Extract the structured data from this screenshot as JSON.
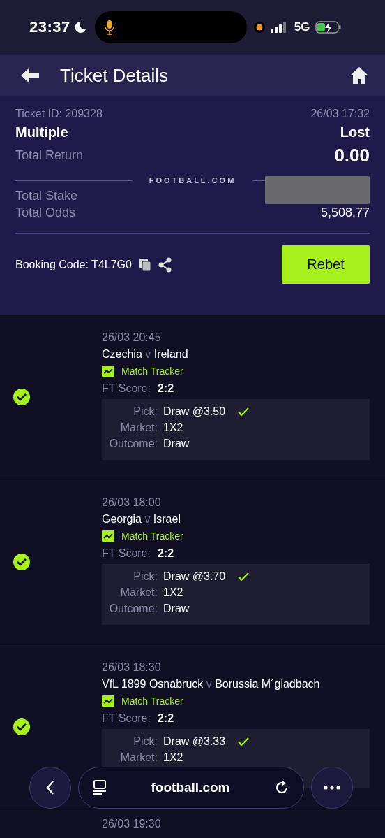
{
  "status_bar": {
    "time": "23:37",
    "network": "5G"
  },
  "header": {
    "title": "Ticket Details"
  },
  "ticket": {
    "ticket_id": "Ticket ID: 209328",
    "date": "26/03 17:32",
    "type": "Multiple",
    "result": "Lost",
    "return_label": "Total Return",
    "return_value": "0.00",
    "divider_logo": "FOOTBALL.COM",
    "stake_label": "Total Stake",
    "odds_label": "Total Odds",
    "odds_value": "5,508.77",
    "booking_code": "Booking Code: T4L7G0",
    "rebet": "Rebet"
  },
  "matches": [
    {
      "date": "26/03 20:45",
      "home": "Czechia",
      "vs": "v",
      "away": "Ireland",
      "tracker": "Match Tracker",
      "score_label": "FT Score:",
      "score": "2:2",
      "pick_label": "Pick:",
      "pick": "Draw @3.50",
      "pick_won": true,
      "market_label": "Market:",
      "market": "1X2",
      "outcome_label": "Outcome:",
      "outcome": "Draw",
      "won": true
    },
    {
      "date": "26/03 18:00",
      "home": "Georgia",
      "vs": "v",
      "away": "Israel",
      "tracker": "Match Tracker",
      "score_label": "FT Score:",
      "score": "2:2",
      "pick_label": "Pick:",
      "pick": "Draw @3.70",
      "pick_won": true,
      "market_label": "Market:",
      "market": "1X2",
      "outcome_label": "Outcome:",
      "outcome": "Draw",
      "won": true
    },
    {
      "date": "26/03 18:30",
      "home": "VfL 1899 Osnabruck",
      "vs": "v",
      "away": "Borussia M´gladbach",
      "tracker": "Match Tracker",
      "score_label": "FT Score:",
      "score": "2:2",
      "pick_label": "Pick:",
      "pick": "Draw @3.33",
      "pick_won": true,
      "market_label": "Market:",
      "market": "1X2",
      "won": true
    },
    {
      "date": "26/03 19:30"
    }
  ],
  "browser_bar": {
    "url": "football.com"
  }
}
